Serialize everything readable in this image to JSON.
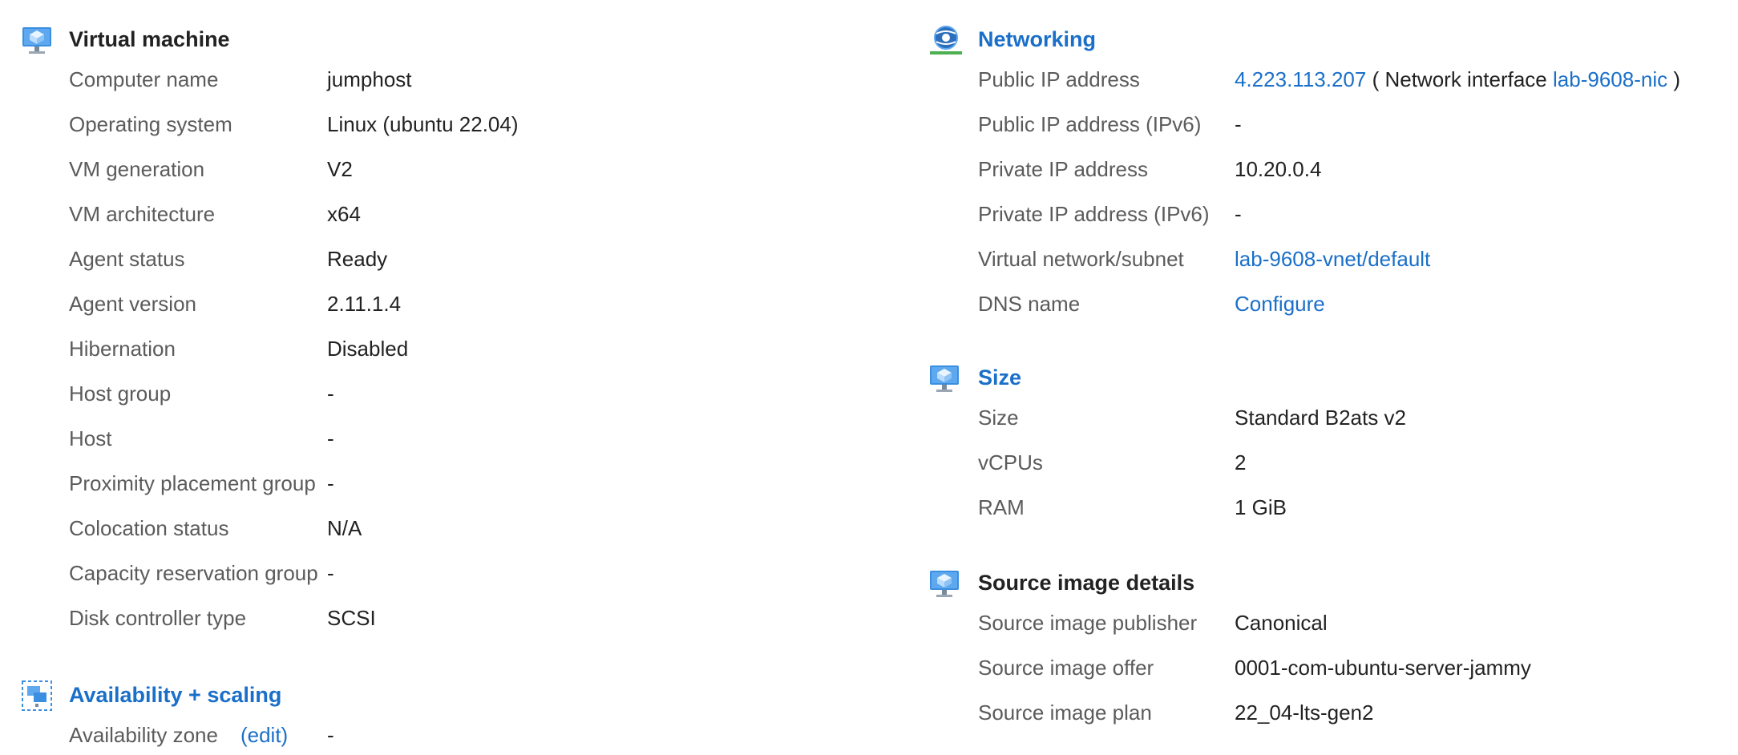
{
  "virtual_machine": {
    "title": "Virtual machine",
    "icon": "vm-icon",
    "rows": [
      {
        "label": "Computer name",
        "value": "jumphost"
      },
      {
        "label": "Operating system",
        "value": "Linux (ubuntu 22.04)"
      },
      {
        "label": "VM generation",
        "value": "V2"
      },
      {
        "label": "VM architecture",
        "value": "x64"
      },
      {
        "label": "Agent status",
        "value": "Ready"
      },
      {
        "label": "Agent version",
        "value": "2.11.1.4"
      },
      {
        "label": "Hibernation",
        "value": "Disabled"
      },
      {
        "label": "Host group",
        "value": "-"
      },
      {
        "label": "Host",
        "value": "-"
      },
      {
        "label": "Proximity placement group",
        "value": "-"
      },
      {
        "label": "Colocation status",
        "value": "N/A"
      },
      {
        "label": "Capacity reservation group",
        "value": "-"
      },
      {
        "label": "Disk controller type",
        "value": "SCSI"
      }
    ]
  },
  "availability": {
    "title": "Availability + scaling",
    "icon": "availability-scaling-icon",
    "zone_label": "Availability zone",
    "zone_edit": "(edit)",
    "zone_value": "-"
  },
  "networking": {
    "title": "Networking",
    "icon": "networking-icon",
    "public_ip_label": "Public IP address",
    "public_ip_value": "4.223.113.207",
    "nic_prefix": "( Network interface",
    "nic_link": "lab-9608-nic",
    "nic_suffix": ")",
    "public_ipv6_label": "Public IP address (IPv6)",
    "public_ipv6_value": "-",
    "private_ip_label": "Private IP address",
    "private_ip_value": "10.20.0.4",
    "private_ipv6_label": "Private IP address (IPv6)",
    "private_ipv6_value": "-",
    "vnet_label": "Virtual network/subnet",
    "vnet_value": "lab-9608-vnet/default",
    "dns_label": "DNS name",
    "dns_value": "Configure"
  },
  "size": {
    "title": "Size",
    "icon": "vm-size-icon",
    "rows": [
      {
        "label": "Size",
        "value": "Standard B2ats v2"
      },
      {
        "label": "vCPUs",
        "value": "2"
      },
      {
        "label": "RAM",
        "value": "1 GiB"
      }
    ]
  },
  "source_image": {
    "title": "Source image details",
    "icon": "source-image-icon",
    "rows": [
      {
        "label": "Source image publisher",
        "value": "Canonical"
      },
      {
        "label": "Source image offer",
        "value": "0001-com-ubuntu-server-jammy"
      },
      {
        "label": "Source image plan",
        "value": "22_04-lts-gen2"
      }
    ]
  },
  "colors": {
    "link": "#1a6fc9",
    "label": "#5b5b5b",
    "value": "#222222"
  }
}
